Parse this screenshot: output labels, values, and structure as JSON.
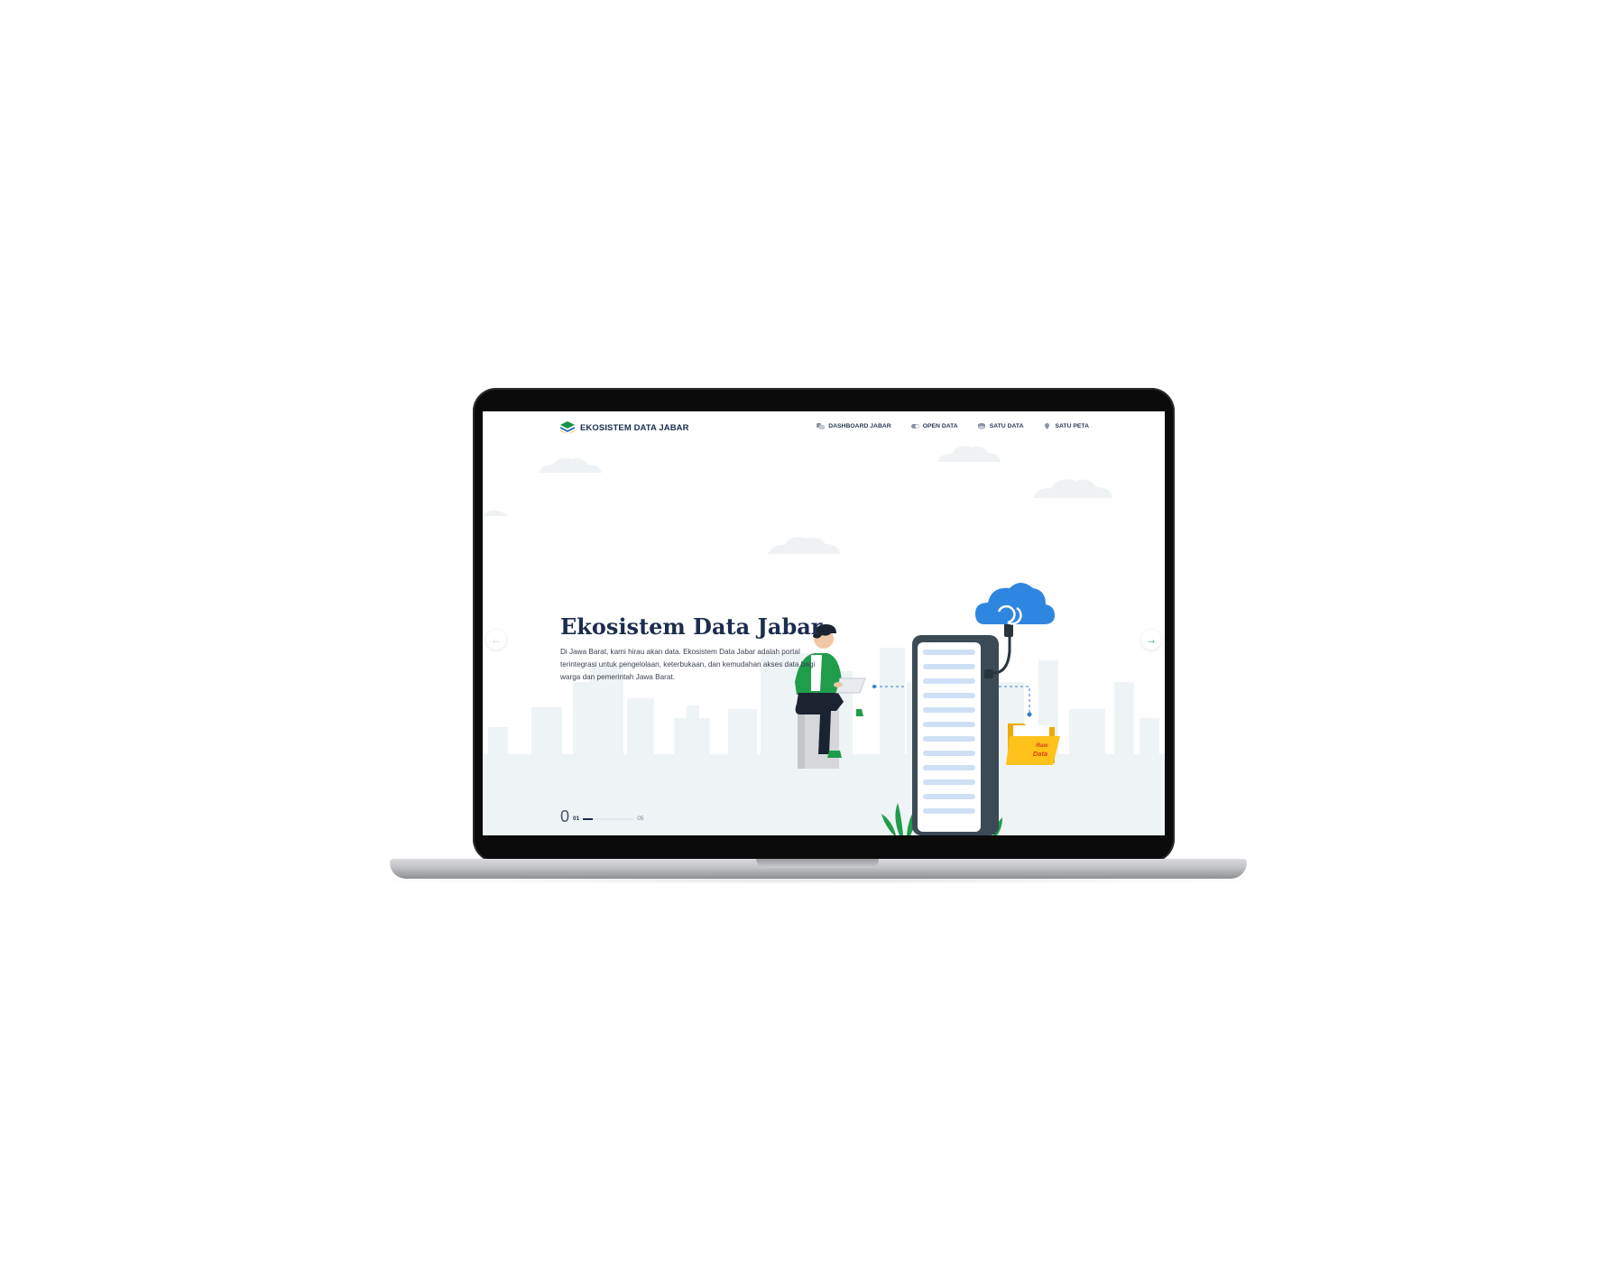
{
  "brand": {
    "name": "EKOSISTEM DATA JABAR",
    "accent": "#159148",
    "navy": "#1c2d4f"
  },
  "nav": [
    {
      "label": "DASHBOARD JABAR",
      "icon": "dashboard-icon"
    },
    {
      "label": "OPEN DATA",
      "icon": "toggle-icon"
    },
    {
      "label": "SATU DATA",
      "icon": "database-icon"
    },
    {
      "label": "SATU PETA",
      "icon": "map-pin-icon"
    }
  ],
  "hero": {
    "title": "Ekosistem Data Jabar",
    "description": "Di Jawa Barat, kami hirau akan data. Ekosistem Data Jabar adalah portal terintegrasi untuk pengelolaan, keterbukaan, dan kemudahan akses data bagi warga dan pemerintah Jawa Barat."
  },
  "illustration": {
    "folder_label_line1": "Raw",
    "folder_label_line2": "Data"
  },
  "slider": {
    "big_digit": "0",
    "current": "01",
    "total": "05",
    "progress": 0.2,
    "prev_icon": "arrow-left-icon",
    "next_icon": "arrow-right-icon"
  }
}
